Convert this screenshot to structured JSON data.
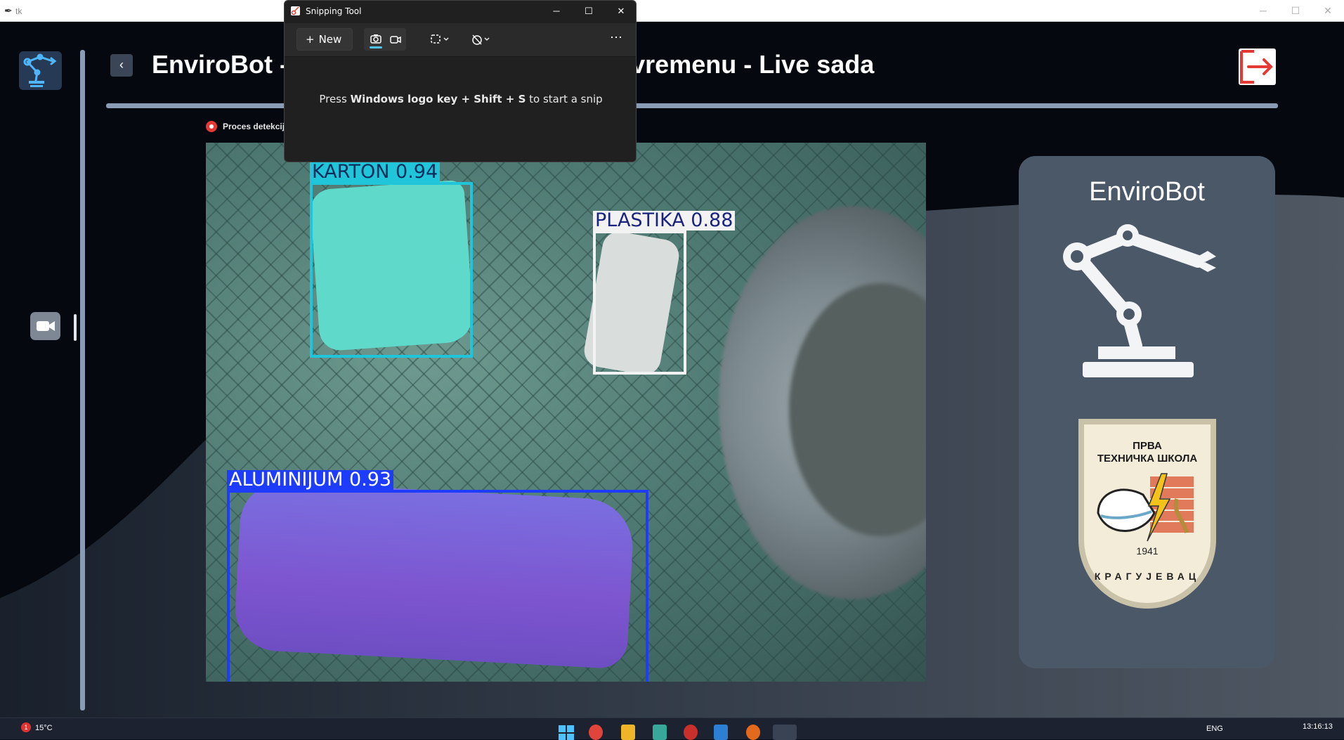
{
  "window": {
    "title": "tk",
    "minimize": "─",
    "maximize": "☐",
    "close": "✕"
  },
  "header": {
    "back_symbol": "‹",
    "title": "EnviroBot - Detekcija otpada u realnom vremenu - Live sada"
  },
  "status": {
    "text": "Proces detekcije je u toku..."
  },
  "detections": [
    {
      "label": "KARTON  0.94",
      "color": "#21c5d9",
      "text_color": "#0d2d5c"
    },
    {
      "label": "PLASTIKA  0.88",
      "color": "#f2f2f2",
      "text_color": "#1a237e"
    },
    {
      "label": "ALUMINIJUM  0.93",
      "color": "#1e3cff",
      "text_color": "#ffffff"
    }
  ],
  "panel": {
    "title": "EnviroBot",
    "seal_line1": "ПРВА",
    "seal_line2": "ТЕХНИЧКА ШКОЛА",
    "seal_year": "1941",
    "seal_city": "КРАГУЈЕВАЦ"
  },
  "snipping_tool": {
    "title": "Snipping Tool",
    "new_label": "New",
    "more": "⋯",
    "message_pre": "Press ",
    "message_keys": "Windows logo key + Shift + S",
    "message_post": " to start a snip",
    "minimize": "─",
    "maximize": "☐",
    "close": "✕"
  },
  "taskbar": {
    "temperature": "15°C",
    "badge": "1",
    "language": "ENG",
    "clock": "13:16:13"
  },
  "colors": {
    "accent": "#8a9bb5",
    "logout": "#e53935",
    "record": "#e53935"
  }
}
